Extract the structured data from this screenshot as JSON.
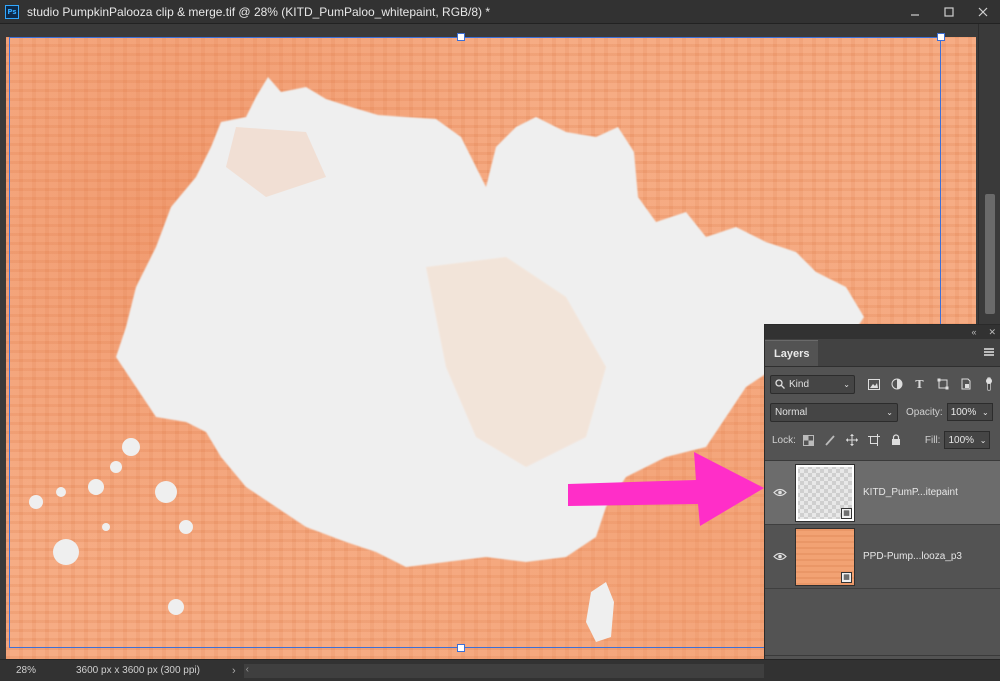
{
  "window": {
    "title": "studio PumpkinPalooza clip & merge.tif @ 28% (KITD_PumPaloo_whitepaint, RGB/8) *",
    "app_badge": "Ps",
    "controls": [
      "minimize",
      "maximize",
      "close"
    ]
  },
  "status_bar": {
    "zoom": "28%",
    "doc_size": "3600 px x 3600 px (300 ppi)"
  },
  "layers_panel": {
    "tab_label": "Layers",
    "filter_kind": "Kind",
    "blend_mode": "Normal",
    "opacity_label": "Opacity:",
    "opacity_value": "100%",
    "lock_label": "Lock:",
    "fill_label": "Fill:",
    "fill_value": "100%",
    "layers": [
      {
        "name": "KITD_PumP...itepaint",
        "visible": true,
        "selected": true,
        "smart_object": true
      },
      {
        "name": "PPD-Pump...looza_p3",
        "visible": true,
        "selected": false,
        "smart_object": true
      }
    ]
  },
  "annotation": {
    "color": "#ff2ec8",
    "points_to": "KITD_PumP...itepaint"
  },
  "colors": {
    "ui_dark": "#323232",
    "panel": "#535353",
    "canvas_paper": "#f4a67c",
    "paint": "#efefef",
    "selection": "#3d6fd6"
  }
}
